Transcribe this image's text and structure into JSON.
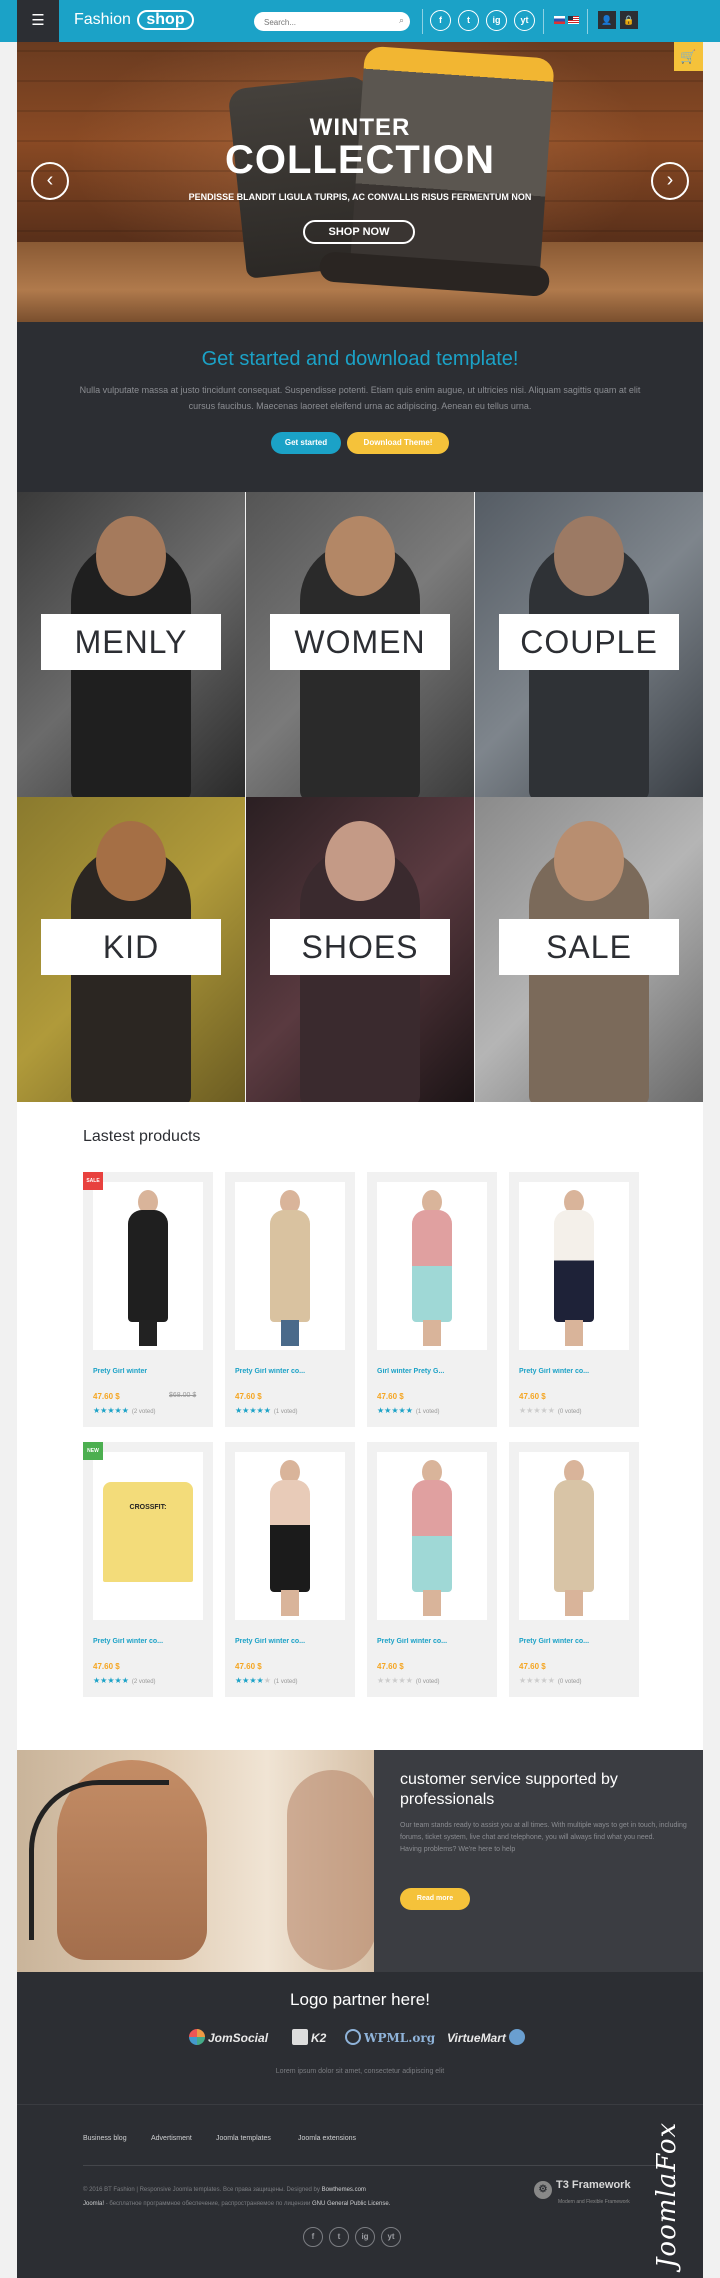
{
  "header": {
    "logo_text": "Fashion",
    "logo_badge": "shop",
    "search_placeholder": "Search...",
    "social": [
      "f",
      "t",
      "ig",
      "yt"
    ],
    "brand_color": "#1ba2c7",
    "dark_color": "#2c2e33",
    "accent_color": "#f5c23a"
  },
  "hero": {
    "title_line1": "WINTER",
    "title_line2": "COLLECTION",
    "subtitle": "PENDISSE BLANDIT LIGULA TURPIS, AC CONVALLIS RISUS FERMENTUM NON",
    "button": "SHOP NOW",
    "prev": "‹",
    "next": "›"
  },
  "get_started": {
    "title": "Get started and download template!",
    "text": "Nulla vulputate massa at justo tincidunt consequat. Suspendisse potenti. Etiam quis enim augue, ut ultricies nisi. Aliquam sagittis quam at elit cursus faucibus. Maecenas laoreet eleifend urna ac adipiscing. Aenean eu tellus urna.",
    "button_primary": "Get started",
    "button_secondary": "Download Theme!"
  },
  "categories": [
    "MENLY",
    "WOMEN",
    "COUPLE",
    "KID",
    "SHOES",
    "SALE"
  ],
  "latest": {
    "title": "Lastest products",
    "products": [
      {
        "name": "Prety Girl winter",
        "price": "47.60 $",
        "old_price": "$68.00 $",
        "rating": 4.5,
        "votes": "(2 voted)",
        "badge": "sale"
      },
      {
        "name": "Prety Girl winter co...",
        "price": "47.60 $",
        "old_price": "",
        "rating": 5,
        "votes": "(1 voted)",
        "badge": ""
      },
      {
        "name": "Girl winter Prety G...",
        "price": "47.60 $",
        "old_price": "",
        "rating": 4.5,
        "votes": "(1 voted)",
        "badge": ""
      },
      {
        "name": "Prety Girl winter co...",
        "price": "47.60 $",
        "old_price": "",
        "rating": 0,
        "votes": "(0 voted)",
        "badge": ""
      },
      {
        "name": "Prety Girl winter co...",
        "price": "47.60 $",
        "old_price": "",
        "rating": 5,
        "votes": "(2 voted)",
        "badge": "new"
      },
      {
        "name": "Prety Girl winter co...",
        "price": "47.60 $",
        "old_price": "",
        "rating": 4,
        "votes": "(1 voted)",
        "badge": ""
      },
      {
        "name": "Prety Girl winter co...",
        "price": "47.60 $",
        "old_price": "",
        "rating": 0,
        "votes": "(0 voted)",
        "badge": ""
      },
      {
        "name": "Prety Girl winter co...",
        "price": "47.60 $",
        "old_price": "",
        "rating": 0,
        "votes": "(0 voted)",
        "badge": ""
      }
    ]
  },
  "service": {
    "title": "customer service supported by professionals",
    "text": "Our team stands ready to assist you at all times. With multiple ways to get in touch, including forums, ticket system, live chat and telephone, you will always find what you need.",
    "text2": "Having problems? We're here to help",
    "button": "Read more"
  },
  "partners": {
    "title": "Logo partner here!",
    "logos": [
      "JomSocial",
      "K2",
      "WPML.org",
      "VirtueMart"
    ],
    "text": "Lorem ipsum dolor sit amet, consectetur adipiscing elit"
  },
  "footer": {
    "links": [
      "Business blog",
      "Advertisment",
      "Joomla templates",
      "Joomla extensions"
    ],
    "copyright_line1": "© 2016 BT Fashion | Responsive Joomla templates. Все права защищены. Designed by",
    "designer": "Bowthemes.com",
    "joomla": "Joomla!",
    "copyright_line2": "- бесплатное программное обеспечение, распространяемое по лицензии",
    "license": "GNU General Public License.",
    "t3_title": "T3 Framework",
    "t3_sub": "Modern and Flexible Framework",
    "social": [
      "f",
      "t",
      "ig",
      "yt"
    ],
    "watermark": "JoomlaFox"
  }
}
